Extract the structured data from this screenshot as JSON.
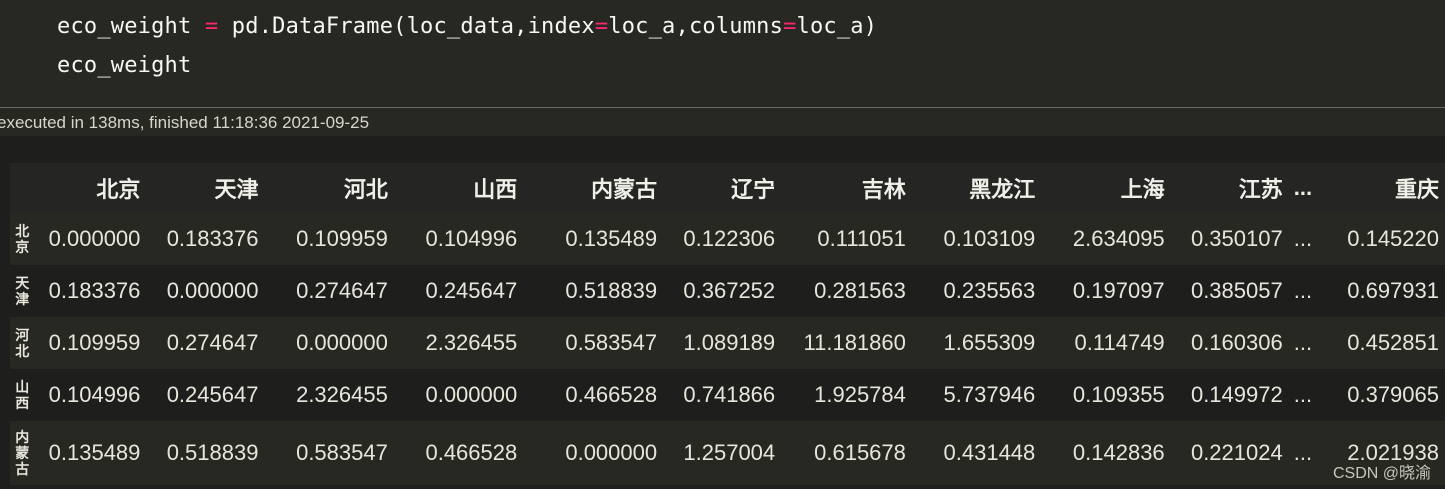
{
  "code": {
    "line1": {
      "var": "eco_weight ",
      "op1": "=",
      "mid": " pd.DataFrame(loc_data,index",
      "op2": "=",
      "mid2": "loc_a,columns",
      "op3": "=",
      "end": "loc_a)"
    },
    "line2": "eco_weight"
  },
  "execution_status": "executed in 138ms, finished 11:18:36 2021-09-25",
  "table": {
    "columns": [
      "北京",
      "天津",
      "河北",
      "山西",
      "内蒙古",
      "辽宁",
      "吉林",
      "黑龙江",
      "上海",
      "江苏",
      "...",
      "重庆"
    ],
    "rows": [
      {
        "label": "北京",
        "values": [
          "0.000000",
          "0.183376",
          "0.109959",
          "0.104996",
          "0.135489",
          "0.122306",
          "0.111051",
          "0.103109",
          "2.634095",
          "0.350107",
          "...",
          "0.145220"
        ]
      },
      {
        "label": "天津",
        "values": [
          "0.183376",
          "0.000000",
          "0.274647",
          "0.245647",
          "0.518839",
          "0.367252",
          "0.281563",
          "0.235563",
          "0.197097",
          "0.385057",
          "...",
          "0.697931"
        ]
      },
      {
        "label": "河北",
        "values": [
          "0.109959",
          "0.274647",
          "0.000000",
          "2.326455",
          "0.583547",
          "1.089189",
          "11.181860",
          "1.655309",
          "0.114749",
          "0.160306",
          "...",
          "0.452851"
        ]
      },
      {
        "label": "山西",
        "values": [
          "0.104996",
          "0.245647",
          "2.326455",
          "0.000000",
          "0.466528",
          "0.741866",
          "1.925784",
          "5.737946",
          "0.109355",
          "0.149972",
          "...",
          "0.379065"
        ]
      },
      {
        "label": "内蒙古",
        "values": [
          "0.135489",
          "0.518839",
          "0.583547",
          "0.466528",
          "0.000000",
          "1.257004",
          "0.615678",
          "0.431448",
          "0.142836",
          "0.221024",
          "...",
          "2.021938"
        ]
      }
    ]
  },
  "watermark": "CSDN @晓渝",
  "colors": {
    "code_bg": "#272822",
    "operator": "#f92672",
    "output_bg": "#1e1f1c"
  }
}
